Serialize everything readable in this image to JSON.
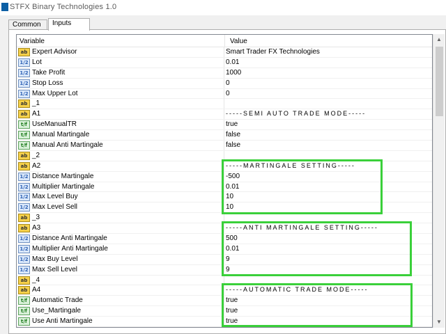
{
  "window": {
    "title": "STFX Binary Technologies 1.0"
  },
  "tabs": [
    {
      "label": "Common"
    },
    {
      "label": "Inputs"
    }
  ],
  "grid": {
    "header_variable": "Variable",
    "header_value": "Value"
  },
  "rows": [
    {
      "icon": "ab",
      "name": "Expert Advisor",
      "value": "Smart Trader FX Technologies"
    },
    {
      "icon": "num",
      "name": "Lot",
      "value": "0.01"
    },
    {
      "icon": "num",
      "name": "Take Profit",
      "value": "1000"
    },
    {
      "icon": "num",
      "name": "Stop Loss",
      "value": "0"
    },
    {
      "icon": "num",
      "name": "Max Upper Lot",
      "value": "0"
    },
    {
      "icon": "ab",
      "name": "_1",
      "value": ""
    },
    {
      "icon": "ab",
      "name": "A1",
      "value": "-----SEMI AUTO TRADE MODE-----"
    },
    {
      "icon": "bool",
      "name": "UseManualTR",
      "value": "true"
    },
    {
      "icon": "bool",
      "name": "Manual Martingale",
      "value": "false"
    },
    {
      "icon": "bool",
      "name": "Manual Anti Martingale",
      "value": "false"
    },
    {
      "icon": "ab",
      "name": "_2",
      "value": ""
    },
    {
      "icon": "ab",
      "name": "A2",
      "value": "-----MARTINGALE SETTING-----"
    },
    {
      "icon": "num",
      "name": "Distance Martingale",
      "value": "-500"
    },
    {
      "icon": "num",
      "name": "Multiplier Martingale",
      "value": "0.01"
    },
    {
      "icon": "num",
      "name": "Max Level Buy",
      "value": "10"
    },
    {
      "icon": "num",
      "name": "Max Level Sell",
      "value": "10"
    },
    {
      "icon": "ab",
      "name": "_3",
      "value": ""
    },
    {
      "icon": "ab",
      "name": "A3",
      "value": "-----ANTI MARTINGALE SETTING-----"
    },
    {
      "icon": "num",
      "name": "Distance Anti Martingale",
      "value": "500"
    },
    {
      "icon": "num",
      "name": "Multiplier Anti Martingale",
      "value": "0.01"
    },
    {
      "icon": "num",
      "name": "Max Buy Level",
      "value": "9"
    },
    {
      "icon": "num",
      "name": "Max Sell Level",
      "value": "9"
    },
    {
      "icon": "ab",
      "name": "_4",
      "value": ""
    },
    {
      "icon": "ab",
      "name": "A4",
      "value": "-----AUTOMATIC TRADE MODE-----"
    },
    {
      "icon": "bool",
      "name": "Automatic Trade",
      "value": "true"
    },
    {
      "icon": "bool",
      "name": "Use_Martingale",
      "value": "true"
    },
    {
      "icon": "bool",
      "name": "Use Anti Martingale",
      "value": "true"
    }
  ],
  "icons": {
    "ab": "ab",
    "num": "1/2",
    "bool": "t/f"
  },
  "colors": {
    "highlight": "#3ad03a"
  }
}
